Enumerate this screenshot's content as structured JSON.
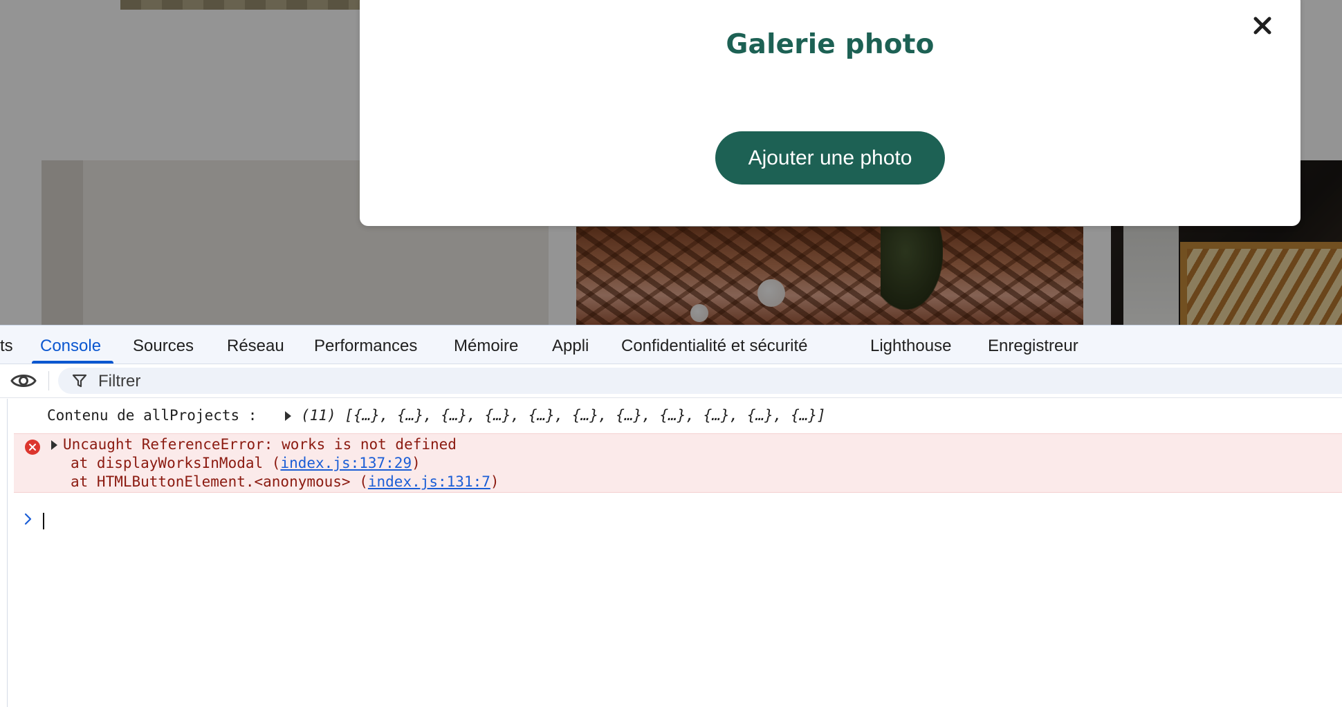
{
  "modal": {
    "title": "Galerie photo",
    "add_photo_label": "Ajouter une photo",
    "close_icon": "close-icon"
  },
  "devtools": {
    "tabs": [
      {
        "label": "ts",
        "active": false
      },
      {
        "label": "Console",
        "active": true
      },
      {
        "label": "Sources",
        "active": false
      },
      {
        "label": "Réseau",
        "active": false
      },
      {
        "label": "Performances",
        "active": false
      },
      {
        "label": "Mémoire",
        "active": false
      },
      {
        "label": "Appli",
        "active": false
      },
      {
        "label": "Confidentialité et sécurité",
        "active": false
      },
      {
        "label": "Lighthouse",
        "active": false
      },
      {
        "label": "Enregistreur",
        "active": false
      }
    ],
    "filter_placeholder": "Filtrer",
    "console": {
      "log": {
        "label": "Contenu de allProjects :",
        "array_preview": "(11) [{…}, {…}, {…}, {…}, {…}, {…}, {…}, {…}, {…}, {…}, {…}]"
      },
      "error": {
        "message": "Uncaught ReferenceError: works is not defined",
        "stack": [
          {
            "prefix": "at displayWorksInModal (",
            "link": "index.js:137:29",
            "suffix": ")"
          },
          {
            "prefix": "at HTMLButtonElement.<anonymous> (",
            "link": "index.js:131:7",
            "suffix": ")"
          }
        ]
      }
    }
  },
  "colors": {
    "brand_green": "#1d6154",
    "devtools_accent": "#0b57d0",
    "error_bg": "#fbeaea",
    "error_icon": "#dc362e"
  }
}
